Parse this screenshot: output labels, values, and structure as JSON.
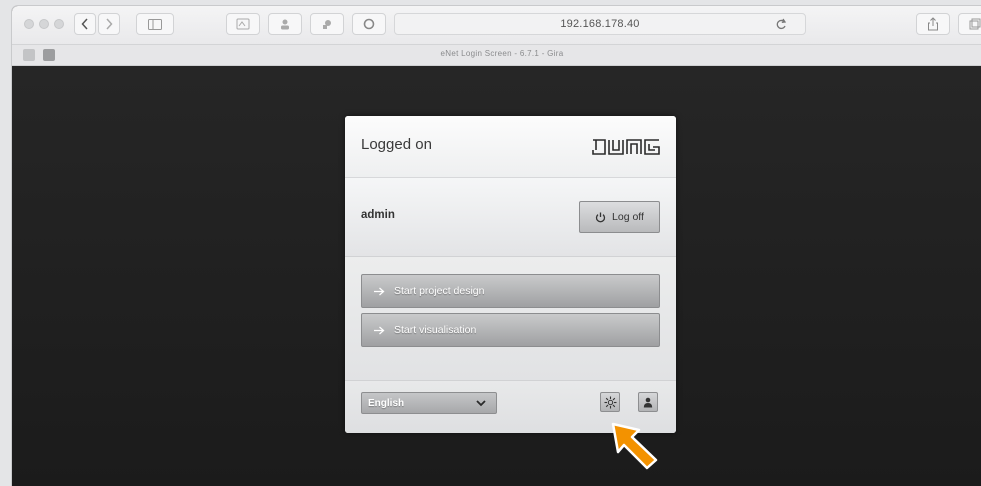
{
  "browser": {
    "address": "192.168.178.40",
    "tab_title": "eNet Login Screen - 6.7.1 - Gira"
  },
  "panel": {
    "title": "Logged on",
    "brand": "JUNG",
    "username": "admin",
    "logoff_label": "Log off",
    "actions": [
      {
        "label": "Start project design"
      },
      {
        "label": "Start visualisation"
      }
    ],
    "language": "English"
  },
  "colors": {
    "pointer": "#f39200",
    "background": "#1d1d1d"
  },
  "icons": [
    "power-icon",
    "arrow-right-icon",
    "chevron-down-icon",
    "settings-gear-icon",
    "user-icon",
    "reload-icon",
    "share-icon"
  ]
}
